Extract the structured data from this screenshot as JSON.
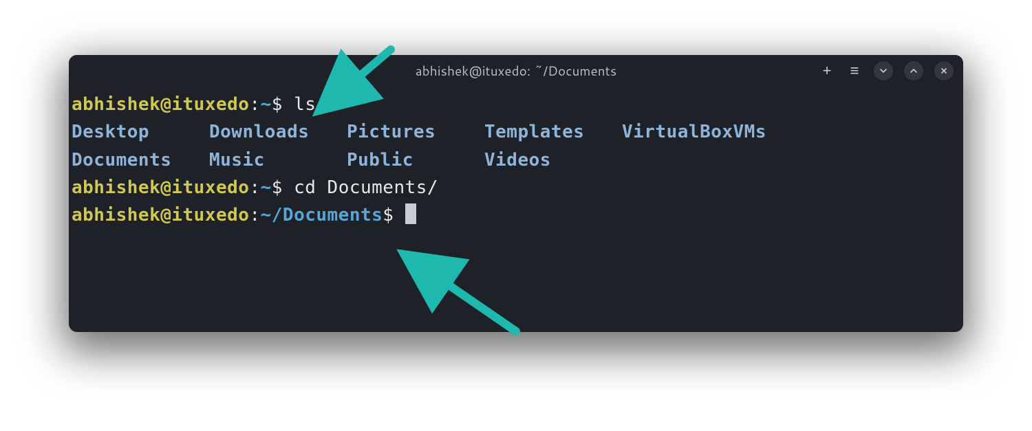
{
  "titlebar": {
    "title": "abhishek@ituxedo: ~/Documents",
    "new_tab": "+",
    "menu": "≡"
  },
  "prompt1": {
    "userhost": "abhishek@ituxedo",
    "colon": ":",
    "path": "~",
    "symbol": "$ ",
    "command": "ls"
  },
  "ls": {
    "row1": {
      "c1": "Desktop",
      "c2": "Downloads",
      "c3": "Pictures",
      "c4": "Templates",
      "c5": "VirtualBoxVMs"
    },
    "row2": {
      "c1": "Documents",
      "c2": "Music",
      "c3": "Public",
      "c4": "Videos",
      "c5": ""
    }
  },
  "prompt2": {
    "userhost": "abhishek@ituxedo",
    "colon": ":",
    "path": "~",
    "symbol": "$ ",
    "command": "cd Documents/"
  },
  "prompt3": {
    "userhost": "abhishek@ituxedo",
    "colon": ":",
    "path": "~/Documents",
    "symbol": "$ "
  },
  "arrow_color": "#1fb8ae"
}
